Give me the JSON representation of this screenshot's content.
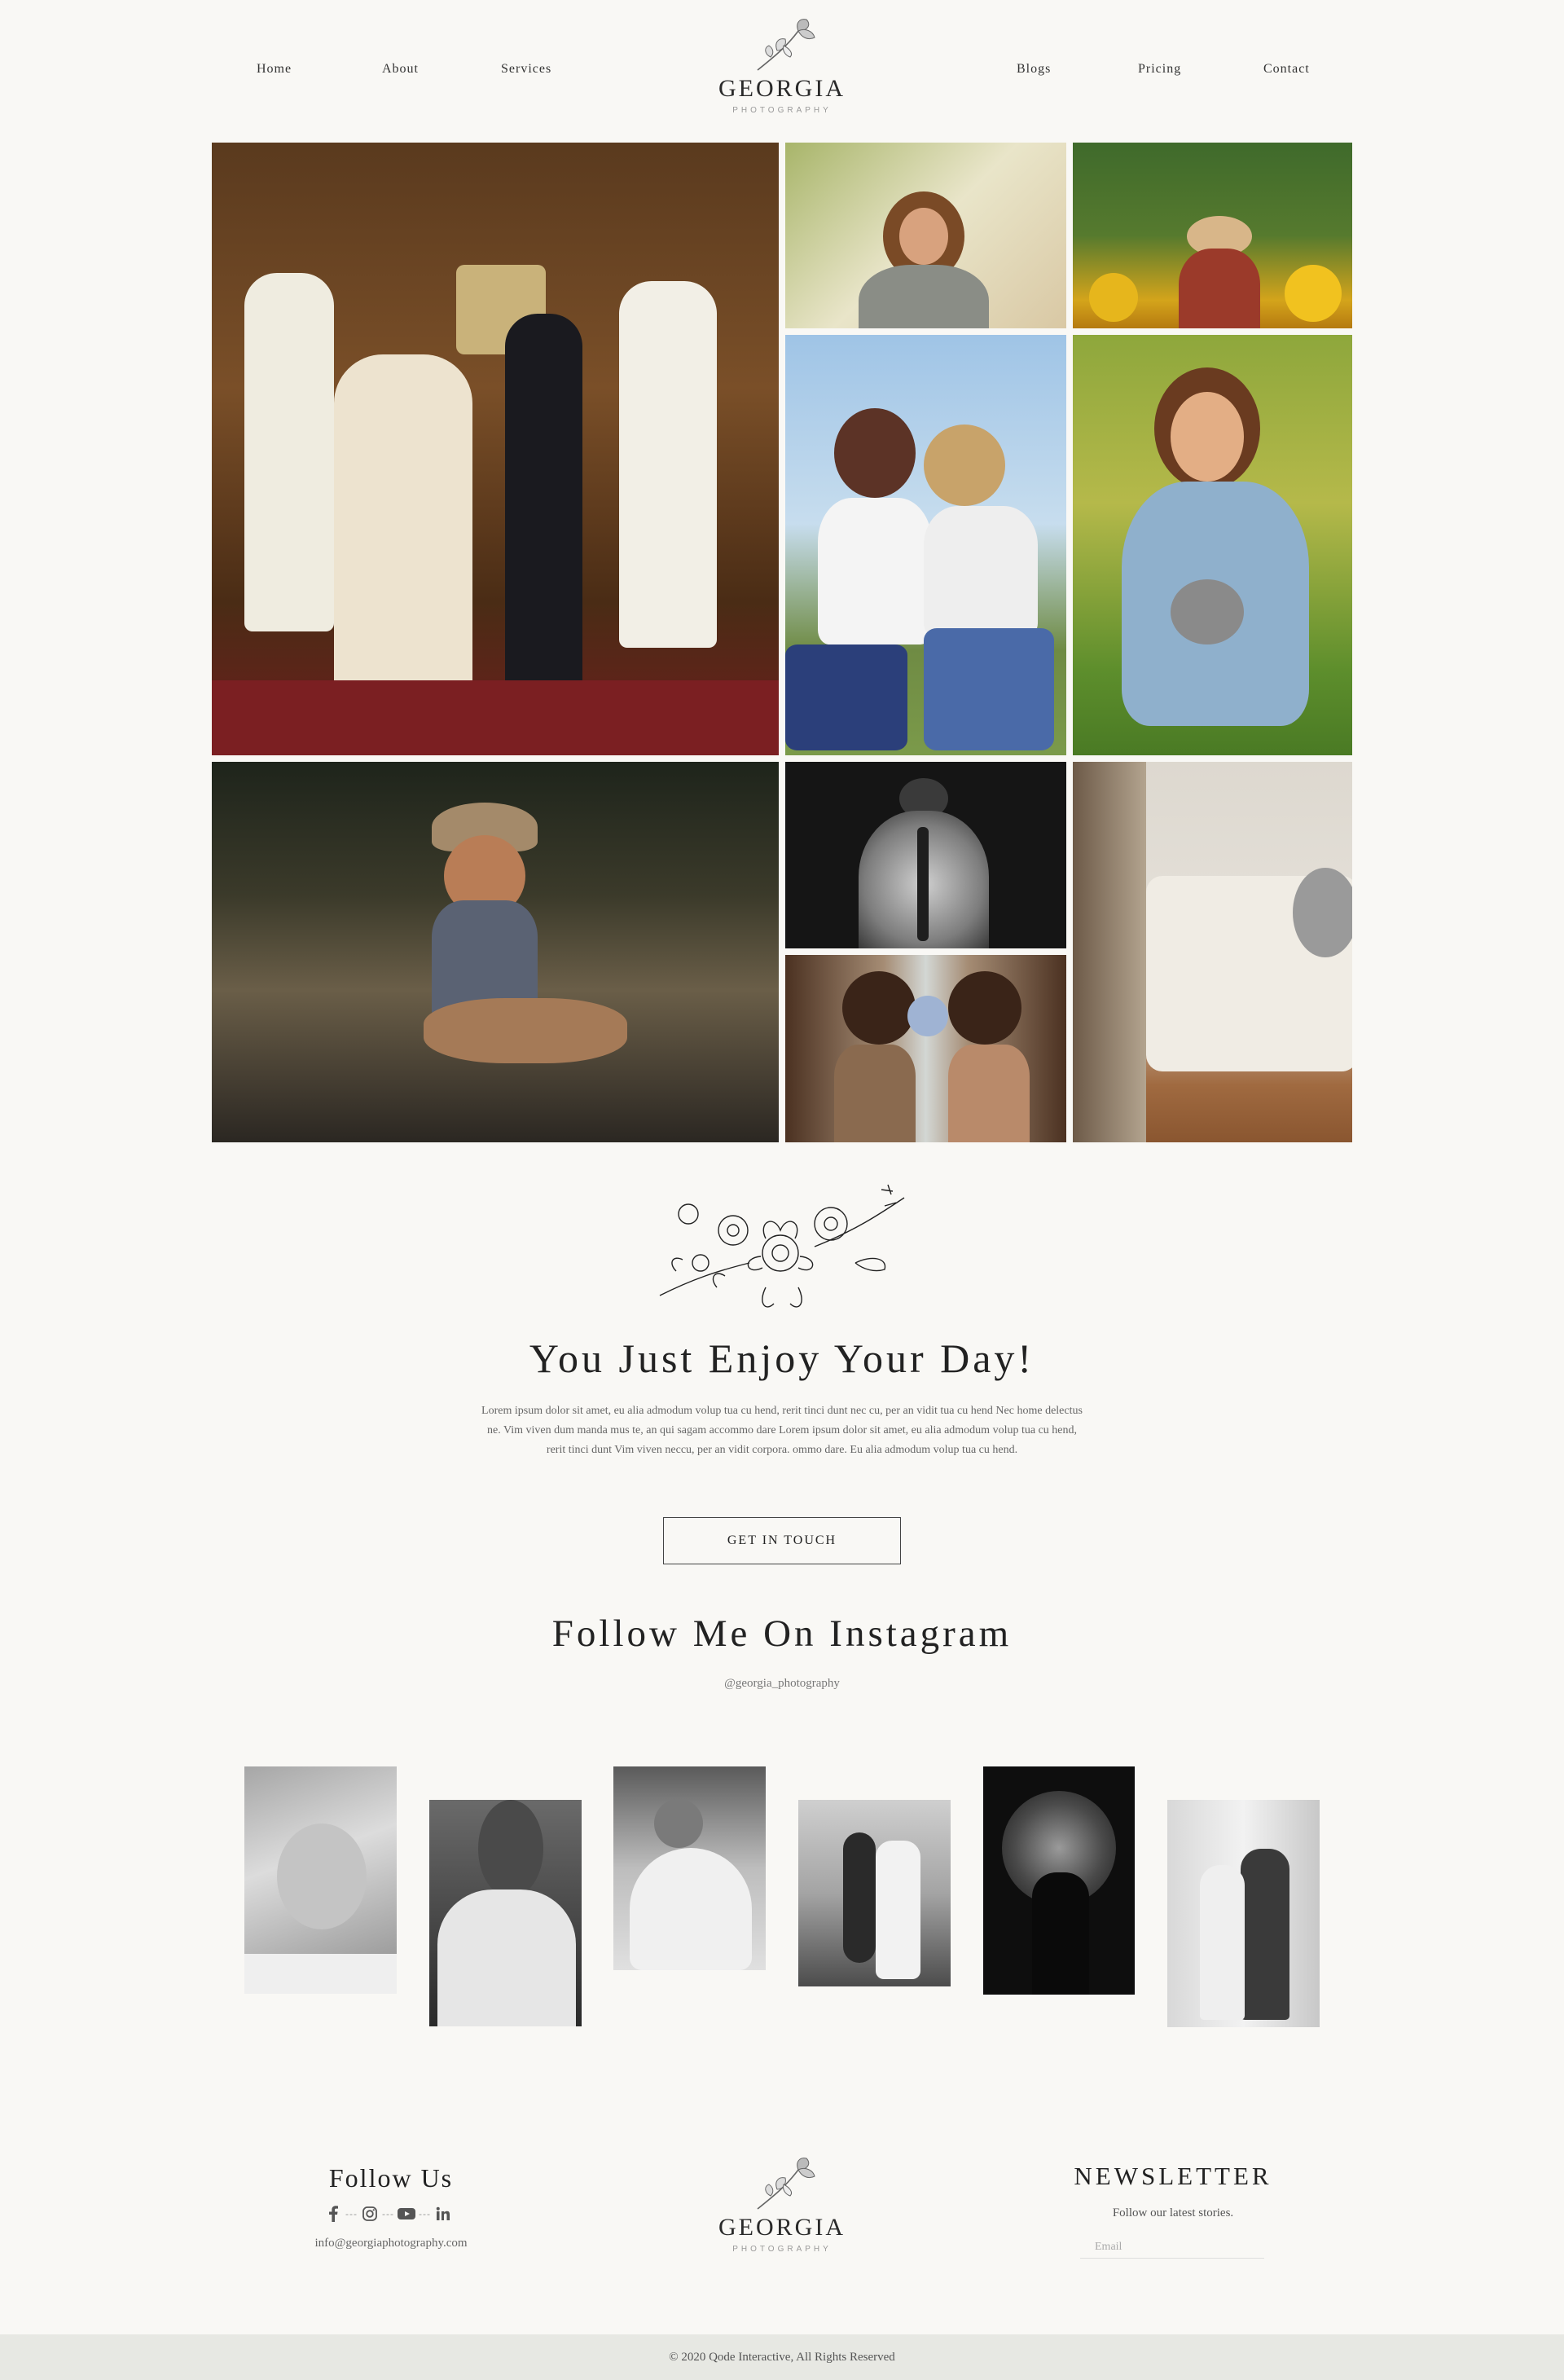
{
  "nav": {
    "left": [
      "Home",
      "About",
      "Services"
    ],
    "right": [
      "Blogs",
      "Pricing",
      "Contact"
    ]
  },
  "logo": {
    "name": "GEORGIA",
    "sub": "PHOTOGRAPHY"
  },
  "gallery": {
    "images": [
      "wedding-ceremony-photo",
      "curly-hair-woman-photo",
      "sunflower-field-photo",
      "two-friends-sunglasses-photo",
      "girl-with-kittens-photo",
      "toddler-in-hat-photo",
      "back-tattoo-bw-photo",
      "two-women-flowers-photo",
      "interior-sofa-photo"
    ]
  },
  "hero": {
    "title": "You Just Enjoy Your Day!",
    "body": "Lorem ipsum dolor sit amet, eu alia admodum volup tua cu hend, rerit tinci dunt nec cu, per an vidit tua cu hend Nec home delectus ne. Vim viven dum manda mus te, an qui sagam accommo dare Lorem ipsum dolor sit amet, eu alia admodum volup tua cu hend, rerit tinci dunt Vim viven neccu, per an vidit corpora. ommo dare. Eu alia admodum volup tua cu hend.",
    "cta": "GET IN TOUCH"
  },
  "instagram": {
    "title": "Follow Me On Instagram",
    "handle": "@georgia_photography"
  },
  "footer": {
    "follow_title": "Follow Us",
    "email": "info@georgiaphotography.com",
    "newsletter_title": "NEWSLETTER",
    "newsletter_sub": "Follow our latest stories.",
    "email_placeholder": "Email",
    "copyright": "© 2020 Qode Interactive, All Rights Reserved",
    "social_icons": [
      "facebook-icon",
      "instagram-icon",
      "youtube-icon",
      "linkedin-icon"
    ]
  }
}
